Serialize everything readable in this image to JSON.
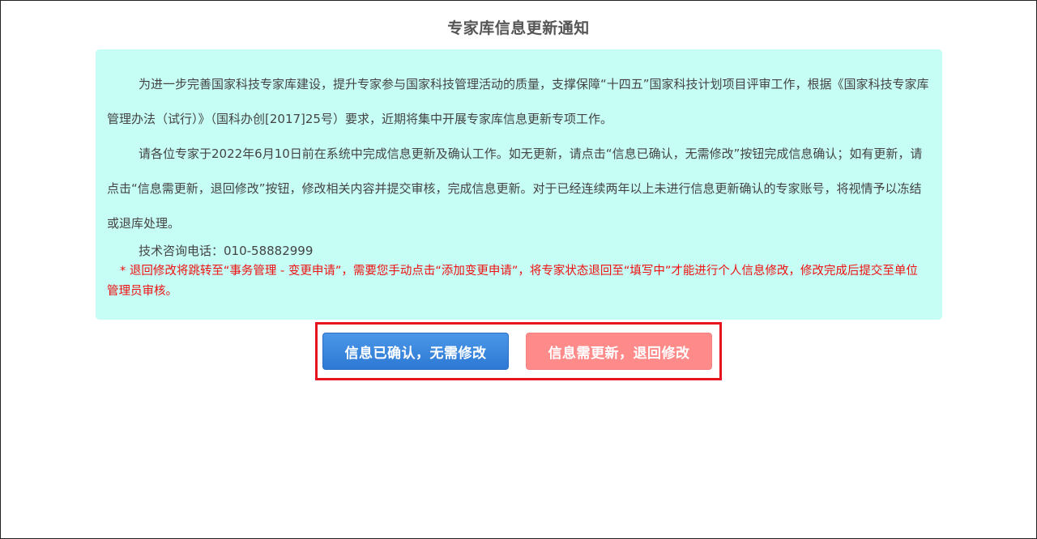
{
  "page": {
    "title": "专家库信息更新通知"
  },
  "notice": {
    "paragraph1": "为进一步完善国家科技专家库建设，提升专家参与国家科技管理活动的质量，支撑保障“十四五”国家科技计划项目评审工作，根据《国家科技专家库管理办法（试行）》（国科办创[2017]25号）要求，近期将集中开展专家库信息更新专项工作。",
    "paragraph2": "请各位专家于2022年6月10日前在系统中完成信息更新及确认工作。如无更新，请点击“信息已确认，无需修改”按钮完成信息确认；如有更新，请点击“信息需更新，退回修改”按钮，修改相关内容并提交审核，完成信息更新。对于已经连续两年以上未进行信息更新确认的专家账号，将视情予以冻结或退库处理。",
    "contact": "技术咨询电话：010-58882999",
    "warning": "* 退回修改将跳转至“事务管理 - 变更申请”，需要您手动点击“添加变更申请”，将专家状态退回至“填写中”才能进行个人信息修改，修改完成后提交至单位管理员审核。"
  },
  "actions": {
    "confirm_label": "信息已确认，无需修改",
    "update_label": "信息需更新，退回修改"
  },
  "colors": {
    "notice_background": "#c6fdf5",
    "warning_text": "#ee1111",
    "confirm_button": "#2d79d4",
    "update_button": "#fe8a8a",
    "highlight_border": "#e6141e"
  }
}
